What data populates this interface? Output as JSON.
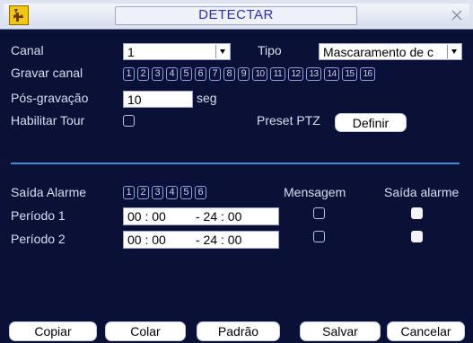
{
  "window": {
    "title": "DETECTAR"
  },
  "settings": {
    "canal_label": "Canal",
    "canal_value": "1",
    "tipo_label": "Tipo",
    "tipo_value": "Mascaramento de c",
    "gravar_label": "Gravar canal",
    "gravar_channels": [
      "1",
      "2",
      "3",
      "4",
      "5",
      "6",
      "7",
      "8",
      "9",
      "10",
      "11",
      "12",
      "13",
      "14",
      "15",
      "16"
    ],
    "pos_label": "Pós-gravação",
    "pos_value": "10",
    "pos_unit": "seg",
    "tour_label": "Habilitar Tour",
    "ptz_label": "Preset PTZ",
    "ptz_button": "Definir"
  },
  "alarm": {
    "saida_label": "Saída Alarme",
    "outputs": [
      "1",
      "2",
      "3",
      "4",
      "5",
      "6"
    ],
    "mensagem_header": "Mensagem",
    "saida_alarme_header": "Saída alarme",
    "periods": [
      {
        "label": "Período 1",
        "start": "00 : 00",
        "end": "- 24 : 00",
        "mensagem": false,
        "saida": true
      },
      {
        "label": "Período 2",
        "start": "00 : 00",
        "end": "- 24 : 00",
        "mensagem": false,
        "saida": true
      }
    ]
  },
  "buttons": {
    "copiar": "Copiar",
    "colar": "Colar",
    "padrao": "Padrão",
    "salvar": "Salvar",
    "cancelar": "Cancelar"
  },
  "icons": {
    "logo": "app-logo-icon",
    "close": "close-icon",
    "dropdown": "chevron-down-icon"
  }
}
